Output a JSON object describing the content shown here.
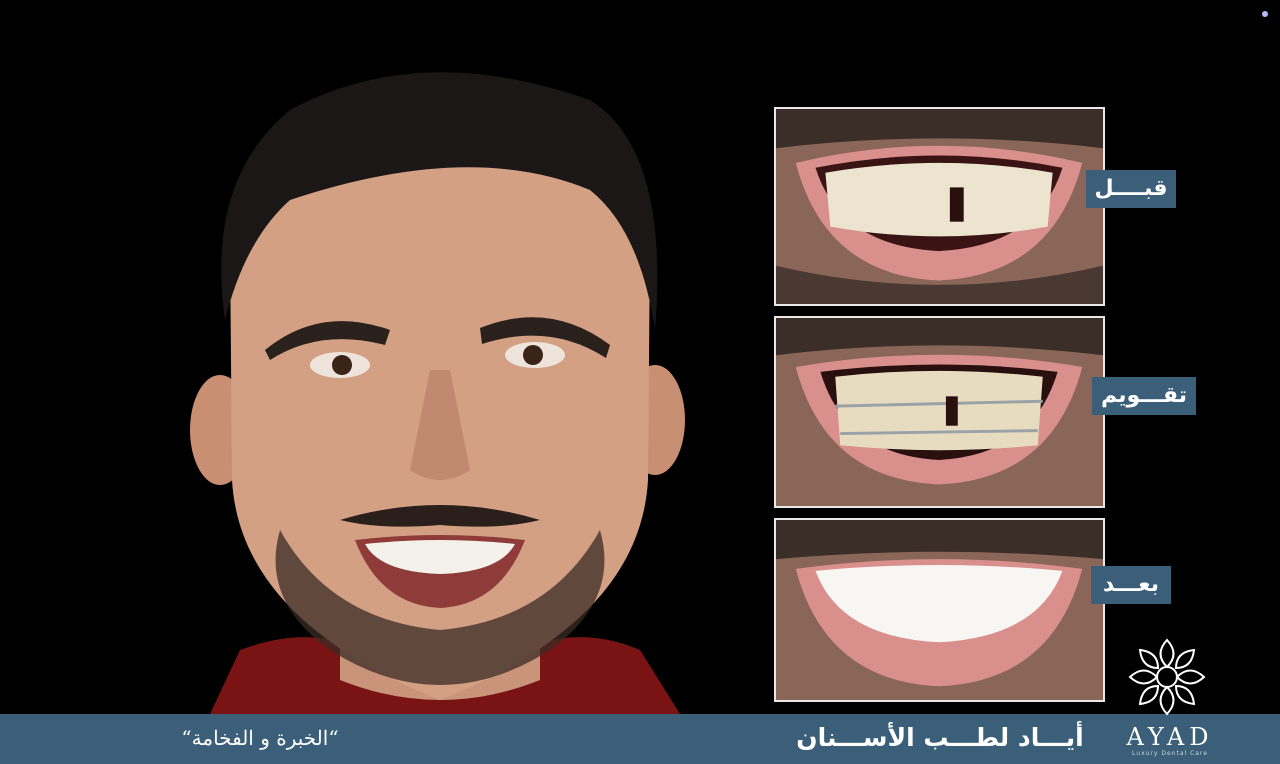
{
  "labels": {
    "before": "قبــــل",
    "braces": "تقـــويم",
    "after": "بعـــد"
  },
  "footer": {
    "tagline": "“الخبرة و الفخامة“",
    "clinic_name": "أيـــاد لطـــب الأســـنان"
  },
  "brand": {
    "name": "AYAD",
    "subtitle": "Luxury Dental Care"
  },
  "colors": {
    "accent": "#3c5f79",
    "background": "#000000",
    "text": "#ffffff"
  },
  "icons": {
    "logo": "floral-emblem-icon",
    "corner": "dot-icon"
  }
}
